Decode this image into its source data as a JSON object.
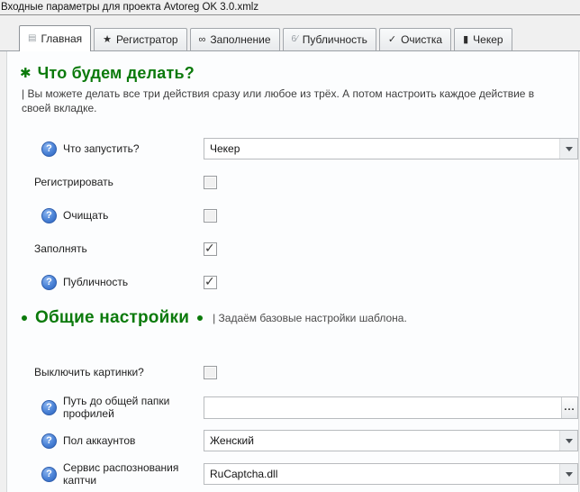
{
  "titlebar": {
    "title": "Входные параметры для проекта Avtoreg OK 3.0.xmlz"
  },
  "tabs": [
    {
      "label": "Главная",
      "icon": "▤"
    },
    {
      "label": "Регистратор",
      "icon": "★"
    },
    {
      "label": "Заполнение",
      "icon": "∞"
    },
    {
      "label": "Публичность",
      "icon": "6⁄"
    },
    {
      "label": "Очистка",
      "icon": "✓"
    },
    {
      "label": "Чекер",
      "icon": "▮"
    }
  ],
  "sections": {
    "actions": {
      "icon": "✱",
      "title": "Что будем делать?",
      "subtitle": "| Вы можете делать все три действия сразу или любое из трёх. А потом настроить каждое действие в своей вкладке."
    },
    "general": {
      "title": "Общие настройки",
      "subtitle": "| Задаём базовые настройки шаблона."
    }
  },
  "form": {
    "help_glyph": "?",
    "what_to_run": {
      "label": "Что запустить?",
      "value": "Чекер"
    },
    "register": {
      "label": "Регистрировать"
    },
    "clean": {
      "label": "Очищать"
    },
    "fill": {
      "label": "Заполнять"
    },
    "publicity": {
      "label": "Публичность"
    },
    "disable_images": {
      "label": "Выключить картинки?"
    },
    "profiles_path": {
      "label": "Путь до общей папки профилей",
      "value": "",
      "browse_label": "..."
    },
    "gender": {
      "label": "Пол аккаунтов",
      "value": "Женский"
    },
    "captcha_service": {
      "label": "Сервис распознования каптчи",
      "value": "RuCaptcha.dll"
    },
    "states": {
      "register": false,
      "clean": false,
      "fill": true,
      "publicity": true,
      "disable_images": false
    }
  },
  "colors": {
    "accent_green": "#0B7A0B",
    "help_blue": "#3A72C8"
  }
}
